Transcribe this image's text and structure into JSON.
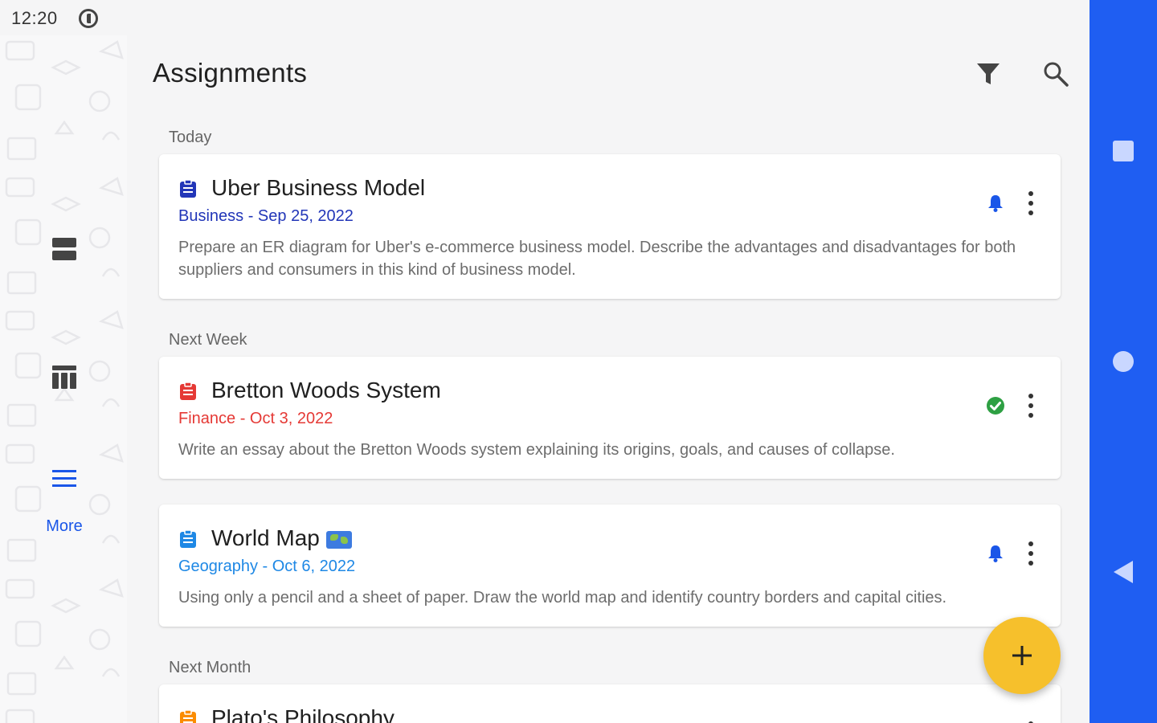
{
  "status": {
    "time": "12:20"
  },
  "rail": {
    "more_label": "More"
  },
  "header": {
    "title": "Assignments"
  },
  "sections": [
    {
      "label": "Today"
    },
    {
      "label": "Next Week"
    },
    {
      "label": "Next Month"
    }
  ],
  "assignments": [
    {
      "title": "Uber Business Model",
      "subject_date": "Business - Sep 25, 2022",
      "description": "Prepare an ER diagram for Uber's e-commerce business model. Describe the advantages and disadvantages for both suppliers and consumers in this kind of business model.",
      "color": "#2236b8",
      "status": "bell-icon"
    },
    {
      "title": "Bretton Woods System",
      "subject_date": "Finance - Oct 3, 2022",
      "description": "Write an essay about the Bretton Woods system explaining its origins, goals, and causes of collapse.",
      "color": "#e53935",
      "status": "check-circle-icon"
    },
    {
      "title": "World Map",
      "subject_date": "Geography - Oct 6, 2022",
      "description": "Using only a pencil and a sheet of paper. Draw the world map and identify country borders and capital cities.",
      "color": "#1e88e5",
      "status": "bell-icon"
    },
    {
      "title": "Plato's Philosophy",
      "color": "#fb8c00"
    }
  ],
  "colors": {
    "accent": "#1f5ef2",
    "fab": "#f6c02c",
    "bell": "#1a56e8",
    "check": "#2ea043"
  }
}
